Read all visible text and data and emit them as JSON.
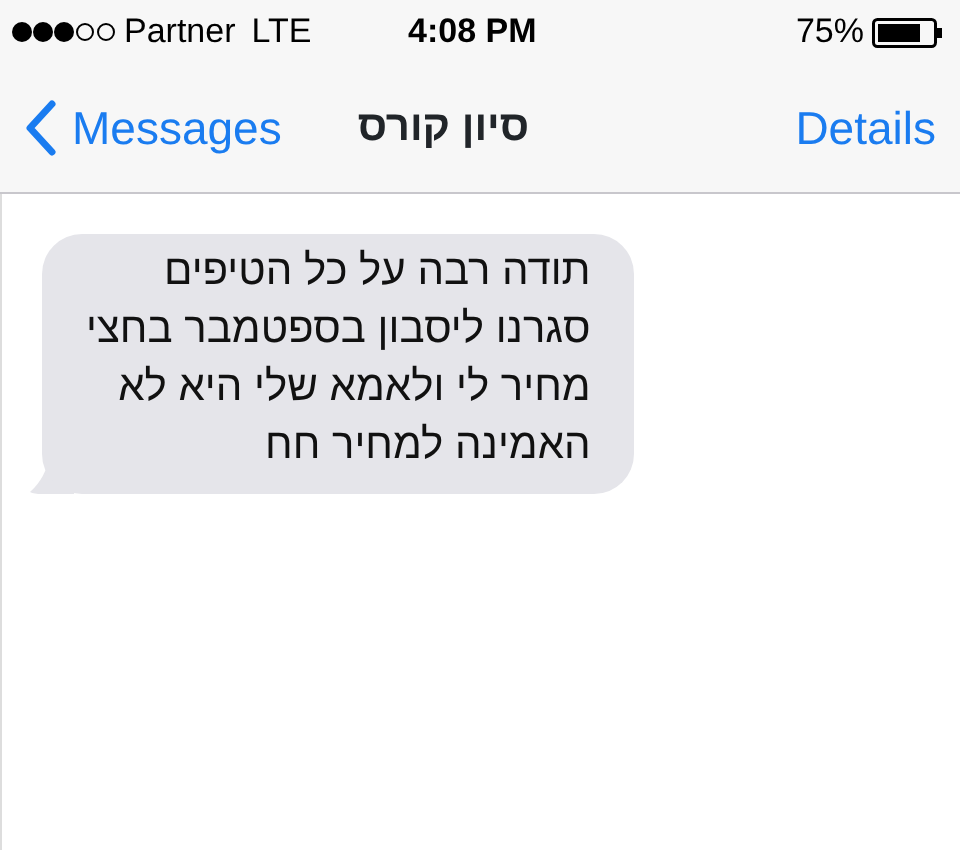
{
  "status_bar": {
    "carrier": "Partner",
    "network": "LTE",
    "time": "4:08 PM",
    "battery": "75%"
  },
  "nav_bar": {
    "back": "Messages",
    "title": "סיון קורס",
    "action": "Details"
  },
  "messages": [
    {
      "kind": "received",
      "text": "תודה רבה על כל הטיפים\nסגרנו ליסבון בספטמבר בחצי\nמחיר לי ולאמא שלי היא לא\nהאמינה למחיר חח"
    }
  ]
}
